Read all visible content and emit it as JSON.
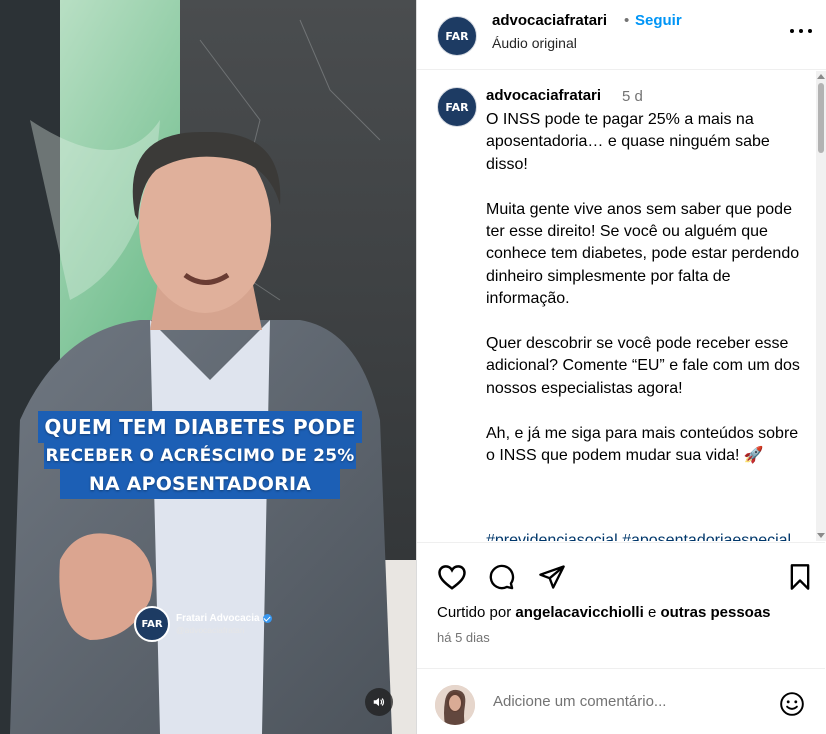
{
  "video": {
    "caption_lines": [
      "QUEM TEM DIABETES PODE",
      "RECEBER O ACRÉSCIMO DE 25%",
      "NA APOSENTADORIA"
    ],
    "brand_name": "Fratari Advocacia",
    "brand_handle": "@advocaciafratari",
    "logo_text": "FAR"
  },
  "header": {
    "username": "advocaciafratari",
    "separator": "•",
    "follow_label": "Seguir",
    "audio_label": "Áudio original"
  },
  "post": {
    "author": "advocaciafratari",
    "age": "5 d",
    "caption": "O INSS pode te pagar 25% a mais na aposentadoria… e quase ninguém sabe disso!\n\nMuita gente vive anos sem saber que pode ter esse direito! Se você ou alguém que conhece tem diabetes, pode estar perdendo dinheiro simplesmente por falta de informação.\n\nQuer descobrir se você pode receber esse adicional? Comente “EU” e fale com um dos nossos especialistas agora!\n\nAh, e já me siga para mais conteúdos sobre o INSS que podem mudar sua vida! 🚀",
    "hashtags": "#previdenciasocial #aposentadoriaespecial"
  },
  "likes": {
    "prefix": "Curtido por ",
    "user": "angelacavicchiolli",
    "middle": " e ",
    "others": "outras pessoas"
  },
  "time_ago": "há 5 dias",
  "comment": {
    "placeholder": "Adicione um comentário..."
  },
  "colors": {
    "accent": "#0095f6",
    "caption_banner": "#1c5fb5",
    "logo_bg": "#1d3b63"
  },
  "icons": [
    "heart-icon",
    "comment-icon",
    "share-icon",
    "bookmark-icon",
    "more-icon",
    "volume-icon",
    "emoji-icon",
    "verified-icon"
  ]
}
